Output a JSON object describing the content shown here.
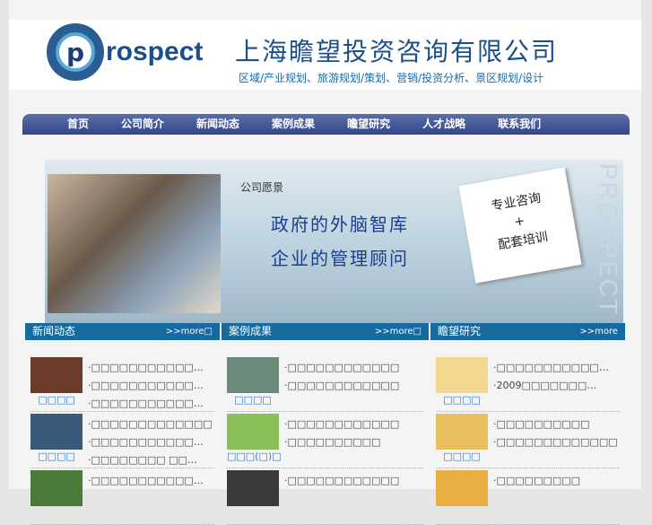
{
  "header": {
    "logo_letter": "p",
    "logo_text": "rospect",
    "company_name": "上海瞻望投资咨询有限公司",
    "slogan": "区域/产业规划、旅游规划/策划、营销/投资分析、景区规划/设计"
  },
  "nav": [
    "首页",
    "公司简介",
    "新闻动态",
    "案例成果",
    "瞻望研究",
    "人才战略",
    "联系我们"
  ],
  "banner": {
    "vision_label": "公司愿景",
    "line1": "政府的外脑智库",
    "line2": "企业的管理顾问",
    "note_line1": "专业咨询",
    "note_plus": "+",
    "note_line2": "配套培训",
    "vertical_text": "PROSPECT"
  },
  "columns": [
    {
      "title": "新闻动态",
      "more": ">>more□",
      "items": [
        {
          "caption": "□□□□",
          "lines": [
            "·□□□□□□□□□□□…",
            "·□□□□□□□□□□□…",
            "·□□□□□□□□□□□…"
          ]
        },
        {
          "caption": "□□□□",
          "lines": [
            "·□□□□□□□□□□□□□",
            "·□□□□□□□□□□□…",
            "·□□□□□□□□ □□…"
          ]
        },
        {
          "caption": "",
          "lines": [
            "·□□□□□□□□□□□…"
          ]
        }
      ]
    },
    {
      "title": "案例成果",
      "more": ">>more□",
      "items": [
        {
          "caption": "□□□□",
          "lines": [
            "·□□□□□□□□□□□□",
            "·□□□□□□□□□□□□"
          ]
        },
        {
          "caption": "□□□(□)□",
          "lines": [
            "·□□□□□□□□□□□□",
            "·□□□□□□□□□□"
          ]
        },
        {
          "caption": "",
          "lines": [
            "·□□□□□□□□□□□□"
          ]
        }
      ]
    },
    {
      "title": "瞻望研究",
      "more": ">>more",
      "items": [
        {
          "caption": "□□□□",
          "lines": [
            "·□□□□□□□□□□□…",
            "·2009□□□□□□□…"
          ]
        },
        {
          "caption": "□□□□",
          "lines": [
            "·□□□□□□□□□□",
            "·□□□□□□□□□□□□□"
          ]
        },
        {
          "caption": "",
          "lines": [
            "·□□□□□□□□□"
          ]
        }
      ]
    }
  ]
}
